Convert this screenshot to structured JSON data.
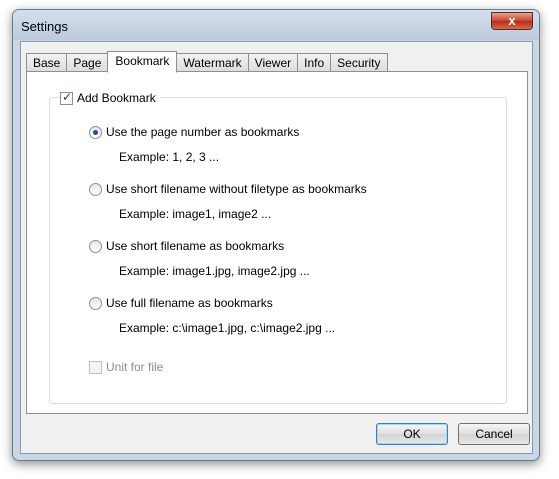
{
  "window": {
    "title": "Settings",
    "close_label": "x"
  },
  "tabs": [
    {
      "label": "Base"
    },
    {
      "label": "Page"
    },
    {
      "label": "Bookmark"
    },
    {
      "label": "Watermark"
    },
    {
      "label": "Viewer"
    },
    {
      "label": "Info"
    },
    {
      "label": "Security"
    }
  ],
  "active_tab": "Bookmark",
  "bookmark": {
    "add_bookmark_label": "Add Bookmark",
    "add_bookmark_checked": true,
    "options": [
      {
        "label": "Use the page number as bookmarks",
        "example": "Example: 1, 2, 3 ...",
        "selected": true
      },
      {
        "label": "Use short filename without filetype as bookmarks",
        "example": "Example: image1, image2 ...",
        "selected": false
      },
      {
        "label": "Use short filename as bookmarks",
        "example": "Example: image1.jpg, image2.jpg ...",
        "selected": false
      },
      {
        "label": "Use full filename as bookmarks",
        "example": "Example: c:\\image1.jpg, c:\\image2.jpg ...",
        "selected": false
      }
    ],
    "unit_for_file_label": "Unit for file",
    "unit_for_file_checked": false,
    "unit_for_file_enabled": false
  },
  "buttons": {
    "ok_label": "OK",
    "cancel_label": "Cancel"
  }
}
